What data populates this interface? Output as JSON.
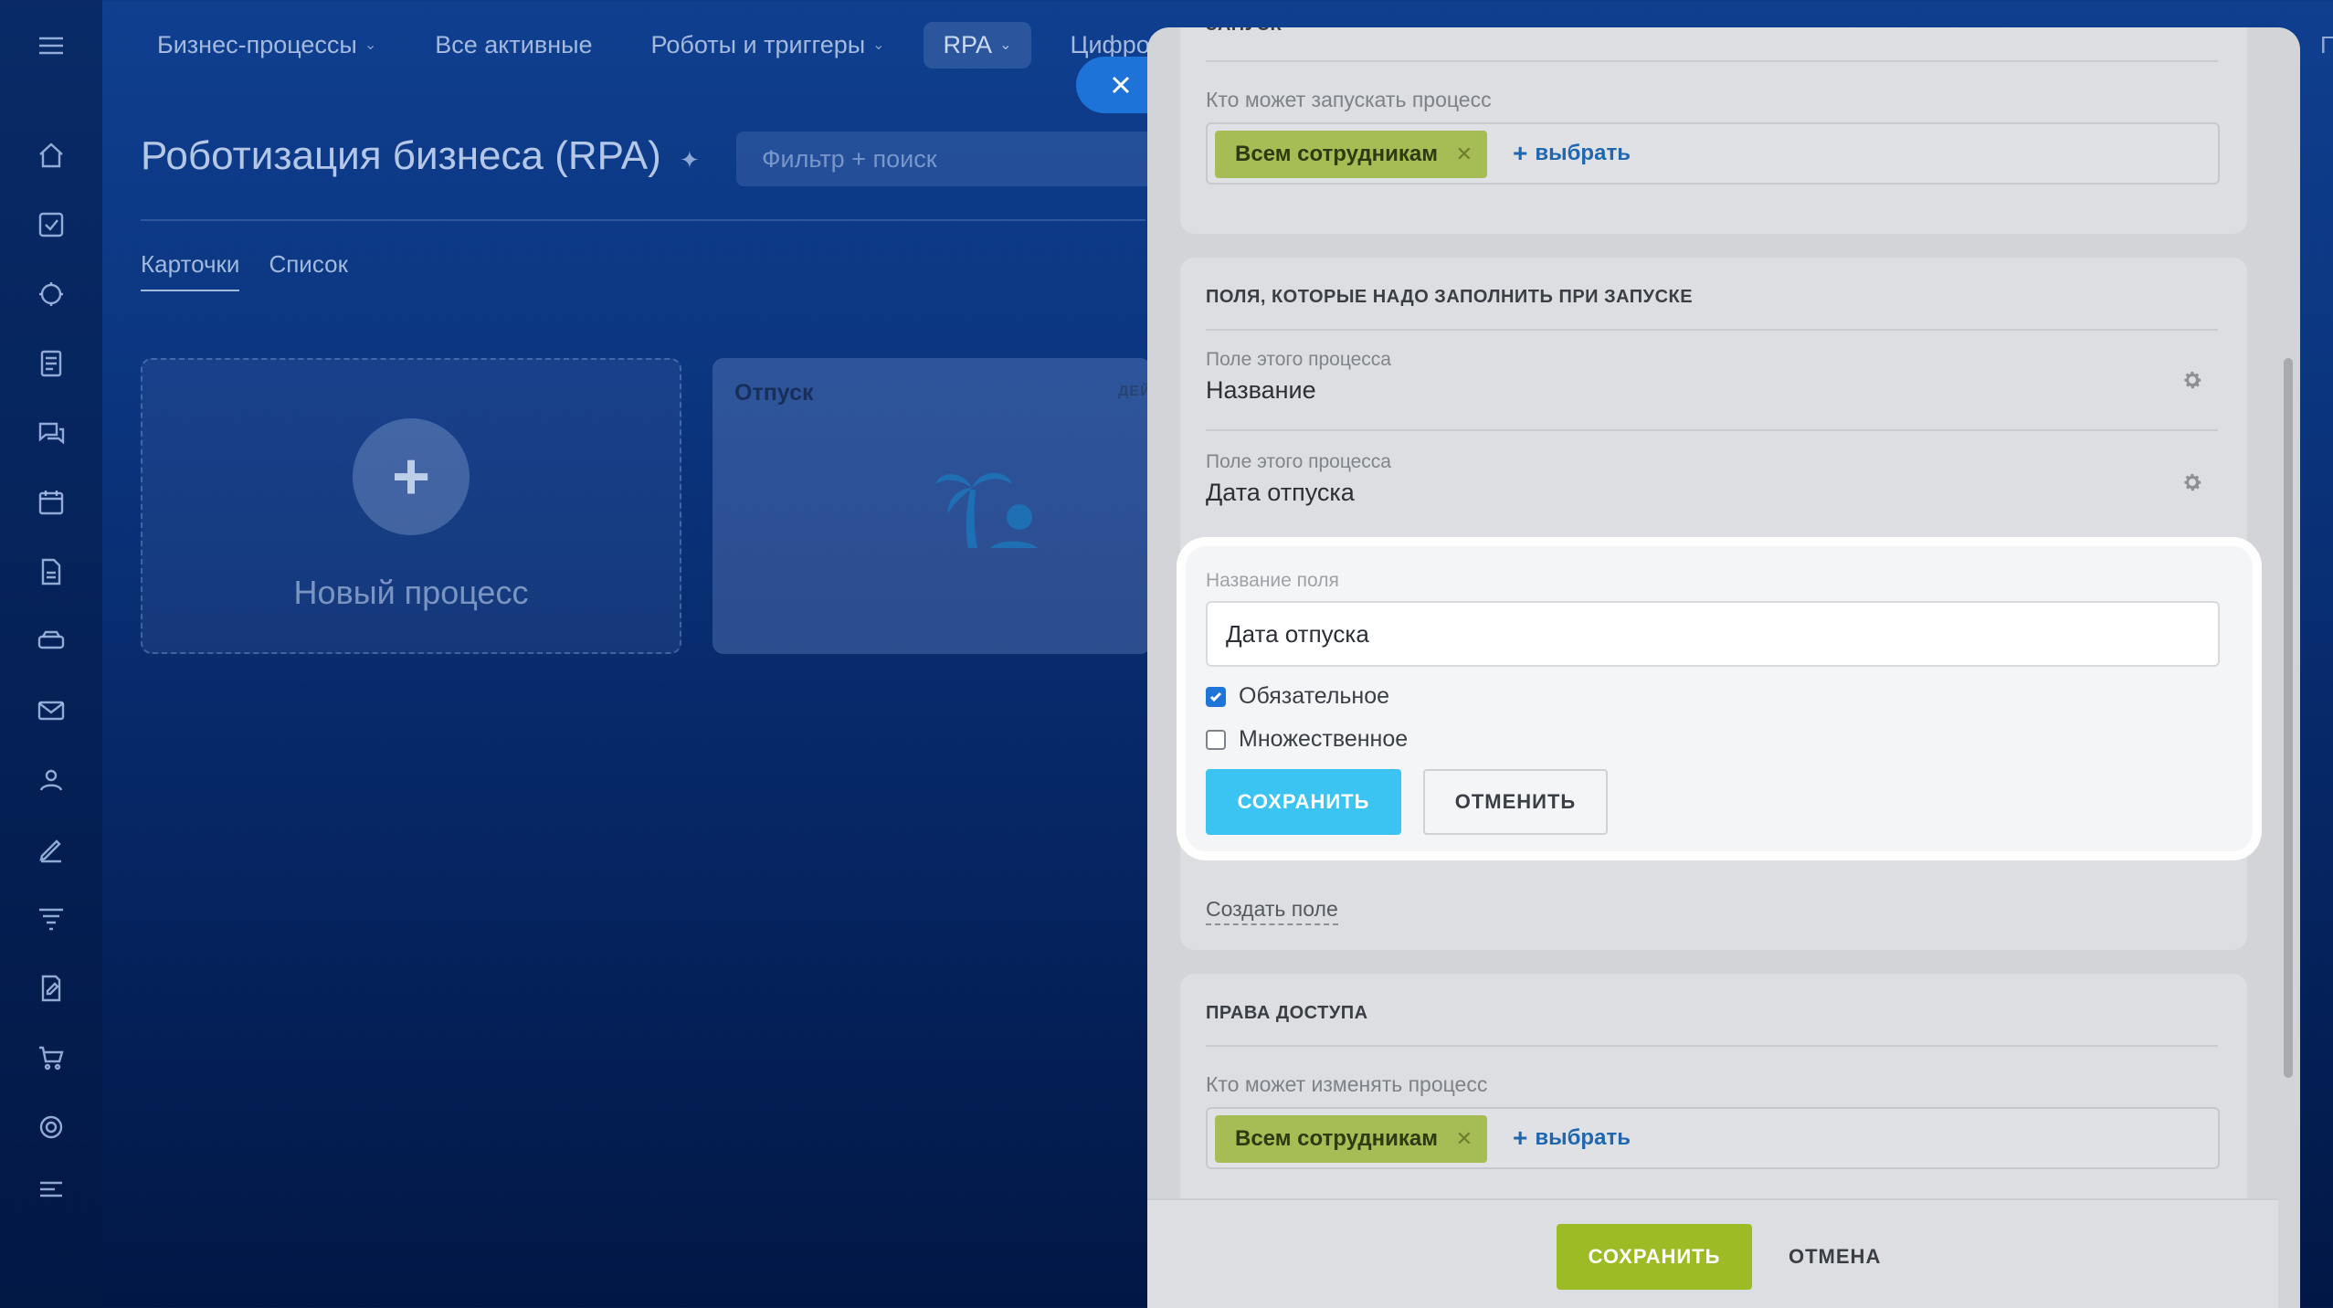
{
  "topnav": {
    "items": [
      {
        "label": "Бизнес-процессы"
      },
      {
        "label": "Все активные"
      },
      {
        "label": "Роботы и триггеры"
      },
      {
        "label": "RPA"
      },
      {
        "label": "Цифровые"
      }
    ],
    "right_label": "П"
  },
  "page": {
    "title": "Роботизация бизнеса (RPA)",
    "filter_placeholder": "Фильтр + поиск",
    "tabs": [
      "Карточки",
      "Список"
    ]
  },
  "cards": {
    "new_label": "Новый процесс",
    "vacation_title": "Отпуск",
    "vacation_badge": "ДЕЙ"
  },
  "panel": {
    "launch": {
      "section_title": "ЗАПУСК",
      "who_caption": "Кто может запускать процесс",
      "tag": "Всем сотрудникам",
      "add_label": "выбрать"
    },
    "fields": {
      "section_title": "ПОЛЯ, КОТОРЫЕ НАДО ЗАПОЛНИТЬ ПРИ ЗАПУСКЕ",
      "rows": [
        {
          "caption": "Поле этого процесса",
          "value": "Название"
        },
        {
          "caption": "Поле этого процесса",
          "value": "Дата отпуска"
        }
      ],
      "create_field_label": "Создать поле"
    },
    "edit": {
      "caption": "Название поля",
      "value": "Дата отпуска",
      "required_label": "Обязательное",
      "required_checked": true,
      "multiple_label": "Множественное",
      "multiple_checked": false,
      "save_label": "СОХРАНИТЬ",
      "cancel_label": "ОТМЕНИТЬ"
    },
    "access": {
      "section_title": "ПРАВА ДОСТУПА",
      "who_caption": "Кто может изменять процесс",
      "tag": "Всем сотрудникам",
      "add_label": "выбрать"
    },
    "footer": {
      "save_label": "СОХРАНИТЬ",
      "cancel_label": "ОТМЕНА"
    }
  },
  "colors": {
    "accent_save": "#3bc4f2",
    "footer_save": "#9dbb24",
    "tag": "#a6bd55",
    "link": "#2067b0"
  }
}
